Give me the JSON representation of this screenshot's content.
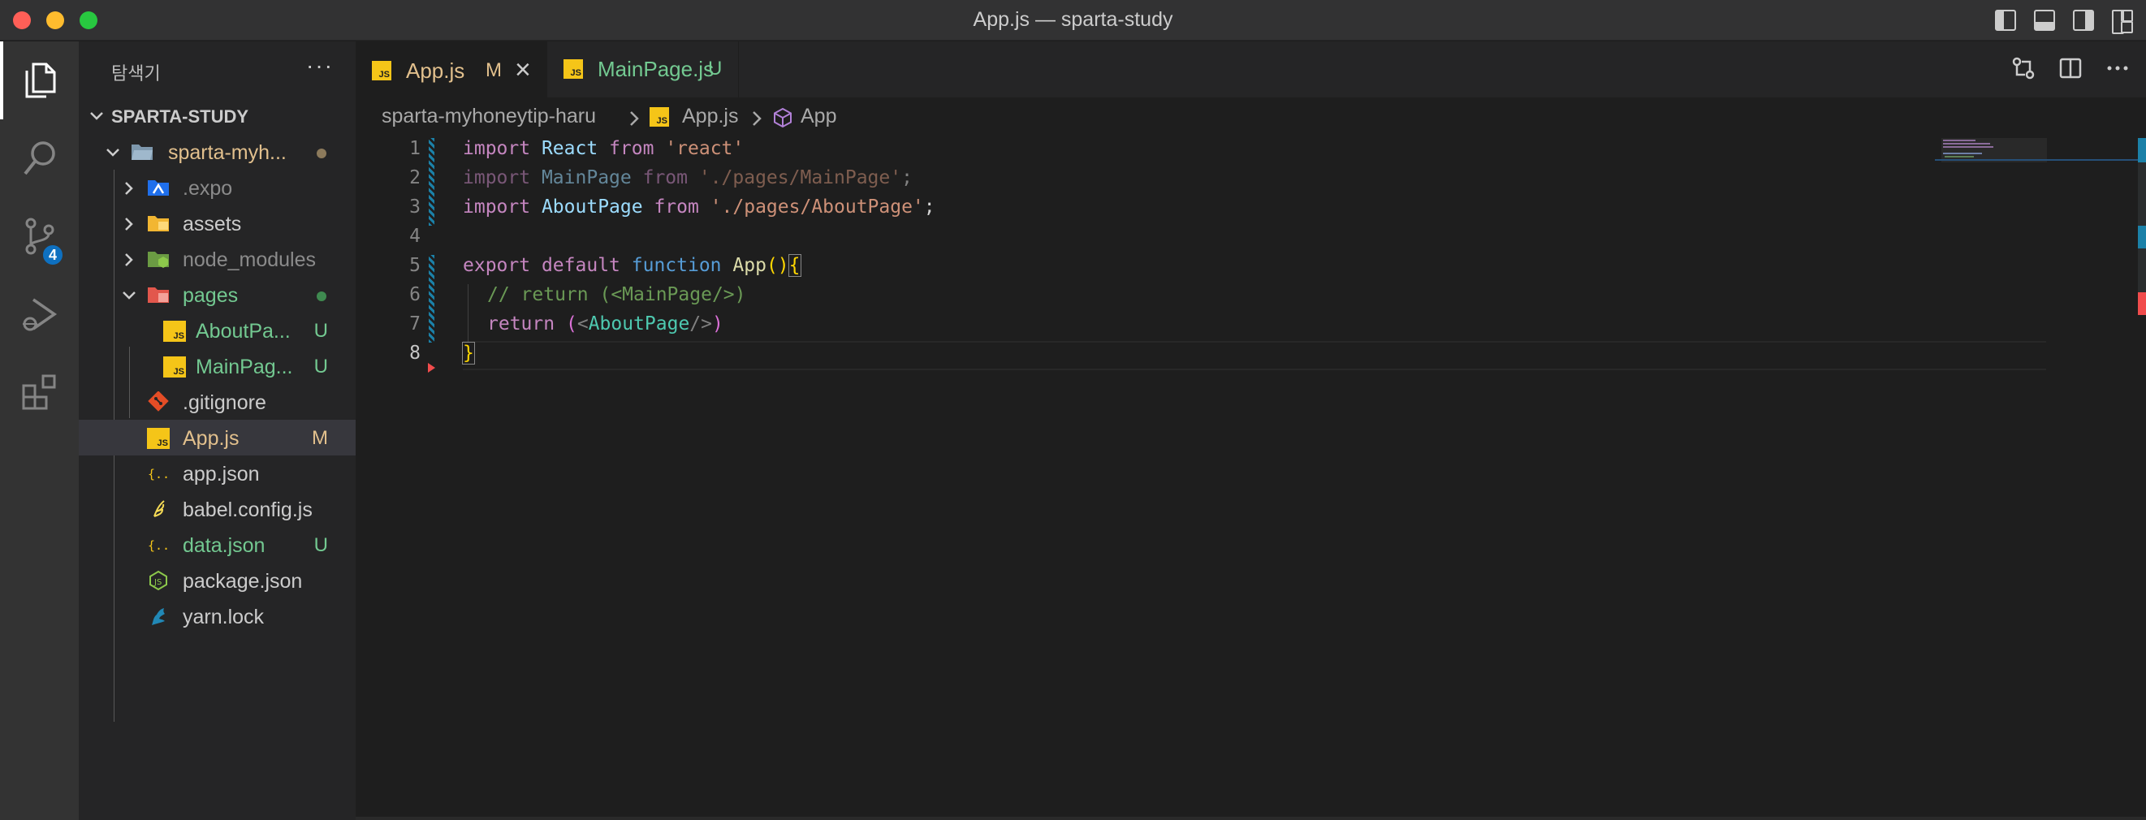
{
  "window": {
    "title": "App.js — sparta-study"
  },
  "activity": {
    "scm_badge": "4"
  },
  "sidebar": {
    "title": "탐색기",
    "more": "···",
    "root": "SPARTA-STUDY",
    "items": [
      {
        "name": "sparta-myh...",
        "type": "folder-open",
        "status": "",
        "dot": "#8c7a5b"
      },
      {
        "name": ".expo",
        "type": "folder",
        "status": ""
      },
      {
        "name": "assets",
        "type": "folder",
        "status": ""
      },
      {
        "name": "node_modules",
        "type": "folder",
        "status": ""
      },
      {
        "name": "pages",
        "type": "folder-open",
        "status": "",
        "dot": "#3f8a50"
      },
      {
        "name": "AboutPa...",
        "type": "file",
        "status": "U"
      },
      {
        "name": "MainPag...",
        "type": "file",
        "status": "U"
      },
      {
        "name": ".gitignore",
        "type": "file",
        "status": ""
      },
      {
        "name": "App.js",
        "type": "file",
        "status": "M"
      },
      {
        "name": "app.json",
        "type": "file",
        "status": ""
      },
      {
        "name": "babel.config.js",
        "type": "file",
        "status": ""
      },
      {
        "name": "data.json",
        "type": "file",
        "status": "U"
      },
      {
        "name": "package.json",
        "type": "file",
        "status": ""
      },
      {
        "name": "yarn.lock",
        "type": "file",
        "status": ""
      }
    ]
  },
  "tabs": [
    {
      "label": "App.js",
      "status": "M",
      "close": "×",
      "active": true
    },
    {
      "label": "MainPage.js",
      "status": "U",
      "active": false
    }
  ],
  "breadcrumb": {
    "folder": "sparta-myhoneytip-haru",
    "file": "App.js",
    "symbol": "App"
  },
  "editor": {
    "line_numbers": [
      "1",
      "2",
      "3",
      "4",
      "5",
      "6",
      "7",
      "8"
    ],
    "current_line": "8",
    "code": {
      "l1": {
        "import": "import",
        "name": "React",
        "from": "from",
        "path": "'react'"
      },
      "l2": {
        "import": "import",
        "name": "MainPage",
        "from": "from",
        "path": "'./pages/MainPage'",
        "semi": ";"
      },
      "l3": {
        "import": "import",
        "name": "AboutPage",
        "from": "from",
        "path": "'./pages/AboutPage'",
        "semi": ";"
      },
      "l5": {
        "export": "export",
        "default": "default",
        "function": "function",
        "name": "App",
        "parens": "()",
        "brace": "{"
      },
      "l6": {
        "comment": "// return (<MainPage/>)"
      },
      "l7": {
        "return": "return",
        "open": "(",
        "lt": "<",
        "tag": "AboutPage",
        "gt": "/>",
        "close": ")"
      },
      "l8": {
        "brace": "}"
      }
    }
  },
  "colors": {
    "accent": "#0e70c0",
    "untracked": "#73c991",
    "modified": "#e2c08d"
  },
  "icons": [
    "explorer-icon",
    "search-icon",
    "source-control-icon",
    "run-debug-icon",
    "extensions-icon",
    "js-file-icon",
    "json-file-icon",
    "git-icon",
    "babel-icon",
    "node-icon",
    "yarn-icon"
  ]
}
